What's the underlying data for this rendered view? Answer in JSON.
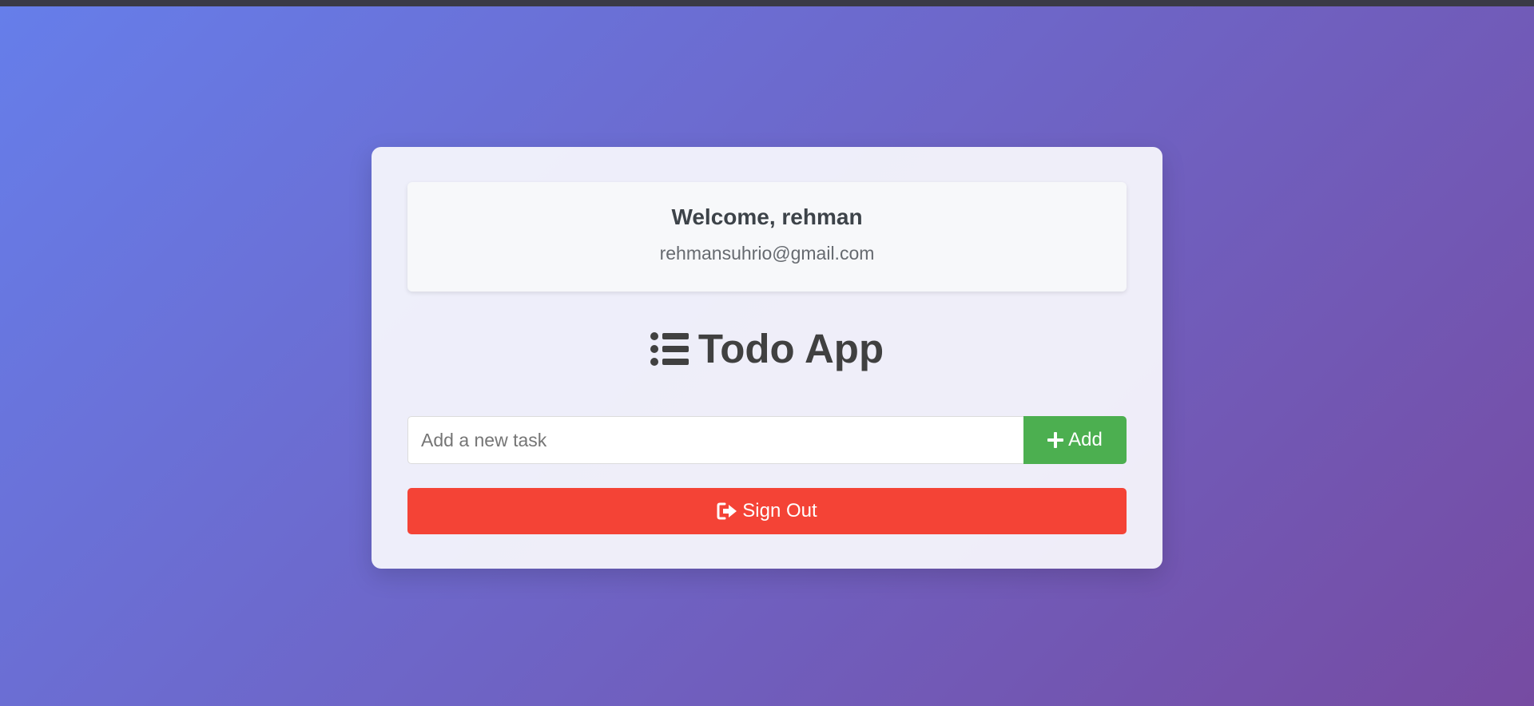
{
  "user": {
    "welcome": "Welcome, rehman",
    "email": "rehmansuhrio@gmail.com"
  },
  "app": {
    "title": "Todo App",
    "icon": "list-icon"
  },
  "task_form": {
    "input_value": "",
    "input_placeholder": "Add a new task",
    "add_label": "Add",
    "add_icon": "plus-icon"
  },
  "signout": {
    "label": "Sign Out",
    "icon": "sign-out-icon"
  },
  "colors": {
    "gradient_start": "#667eea",
    "gradient_end": "#764ba2",
    "add_button": "#4caf50",
    "signout_button": "#f44336",
    "title_text": "#404040"
  }
}
